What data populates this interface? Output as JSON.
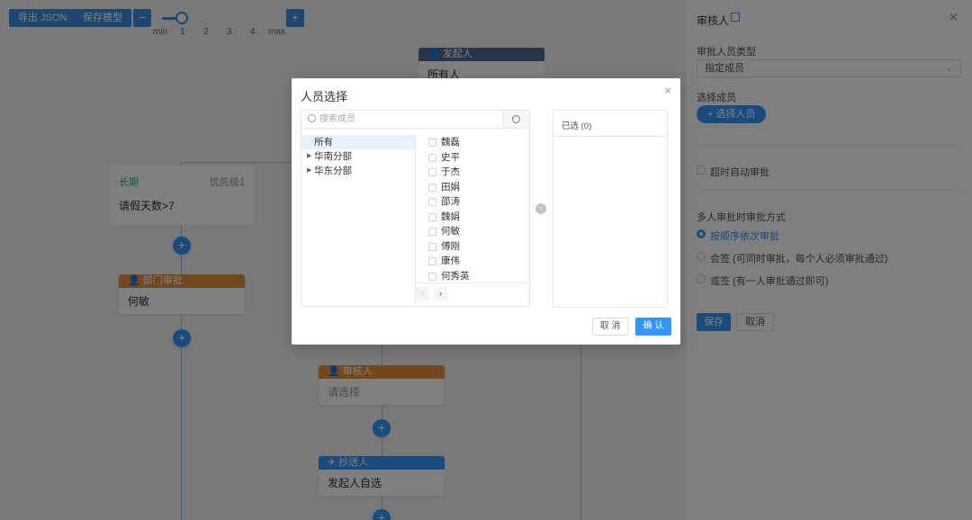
{
  "toolbar": {
    "export_json": "导出 JSON",
    "save_model": "保存模型",
    "zoom_out": "−",
    "zoom_in": "+",
    "zoom_level": 0.25,
    "zoom_ticks": [
      "min",
      "1",
      "2",
      "3",
      "4",
      "max"
    ]
  },
  "canvas": {
    "start_node": {
      "header": "发起人",
      "body": "所有人"
    },
    "condition_node": {
      "title": "长期",
      "priority": "优先级1",
      "text": "请假天数>7"
    },
    "left_approver_node": {
      "header": "部门审批",
      "body": "何敏"
    },
    "auditor_node": {
      "header": "审核人",
      "body": "请选择"
    },
    "cc_node": {
      "header": "抄送人",
      "body": "发起人自选"
    },
    "add_button": "+"
  },
  "drawer": {
    "title": "审核人",
    "close": "×",
    "type_label": "审批人员类型",
    "type_value": "指定成员",
    "select_label": "选择成员",
    "select_button": "+ 选择人员",
    "timeout_label": "超时自动审批",
    "mode_label": "多人审批时审批方式",
    "mode_options": [
      {
        "label": "按顺序依次审批",
        "selected": true
      },
      {
        "label": "会签 (可同时审批，每个人必须审批通过)",
        "selected": false
      },
      {
        "label": "或签 (有一人审批通过即可)",
        "selected": false
      }
    ],
    "save": "保存",
    "cancel": "取消"
  },
  "modal": {
    "title": "人员选择",
    "close": "×",
    "search_placeholder": "搜索成员",
    "tree": [
      {
        "label": "所有",
        "selected": true,
        "expandable": false
      },
      {
        "label": "华南分部",
        "selected": false,
        "expandable": true
      },
      {
        "label": "华东分部",
        "selected": false,
        "expandable": true
      }
    ],
    "members": [
      "魏磊",
      "史平",
      "于杰",
      "田娟",
      "邵涛",
      "魏娟",
      "何敏",
      "傅刚",
      "康伟",
      "何秀英"
    ],
    "pager": {
      "prev": "‹",
      "next": "›"
    },
    "transfer_arrow": "›",
    "selected_header": "已选 (0)",
    "cancel": "取 消",
    "confirm": "确 认"
  },
  "colors": {
    "accent": "#3296fa",
    "start_header": "#576a95",
    "approver_header": "#e6913a",
    "cc_header": "#3296fa",
    "condition_title": "#15bc83"
  }
}
